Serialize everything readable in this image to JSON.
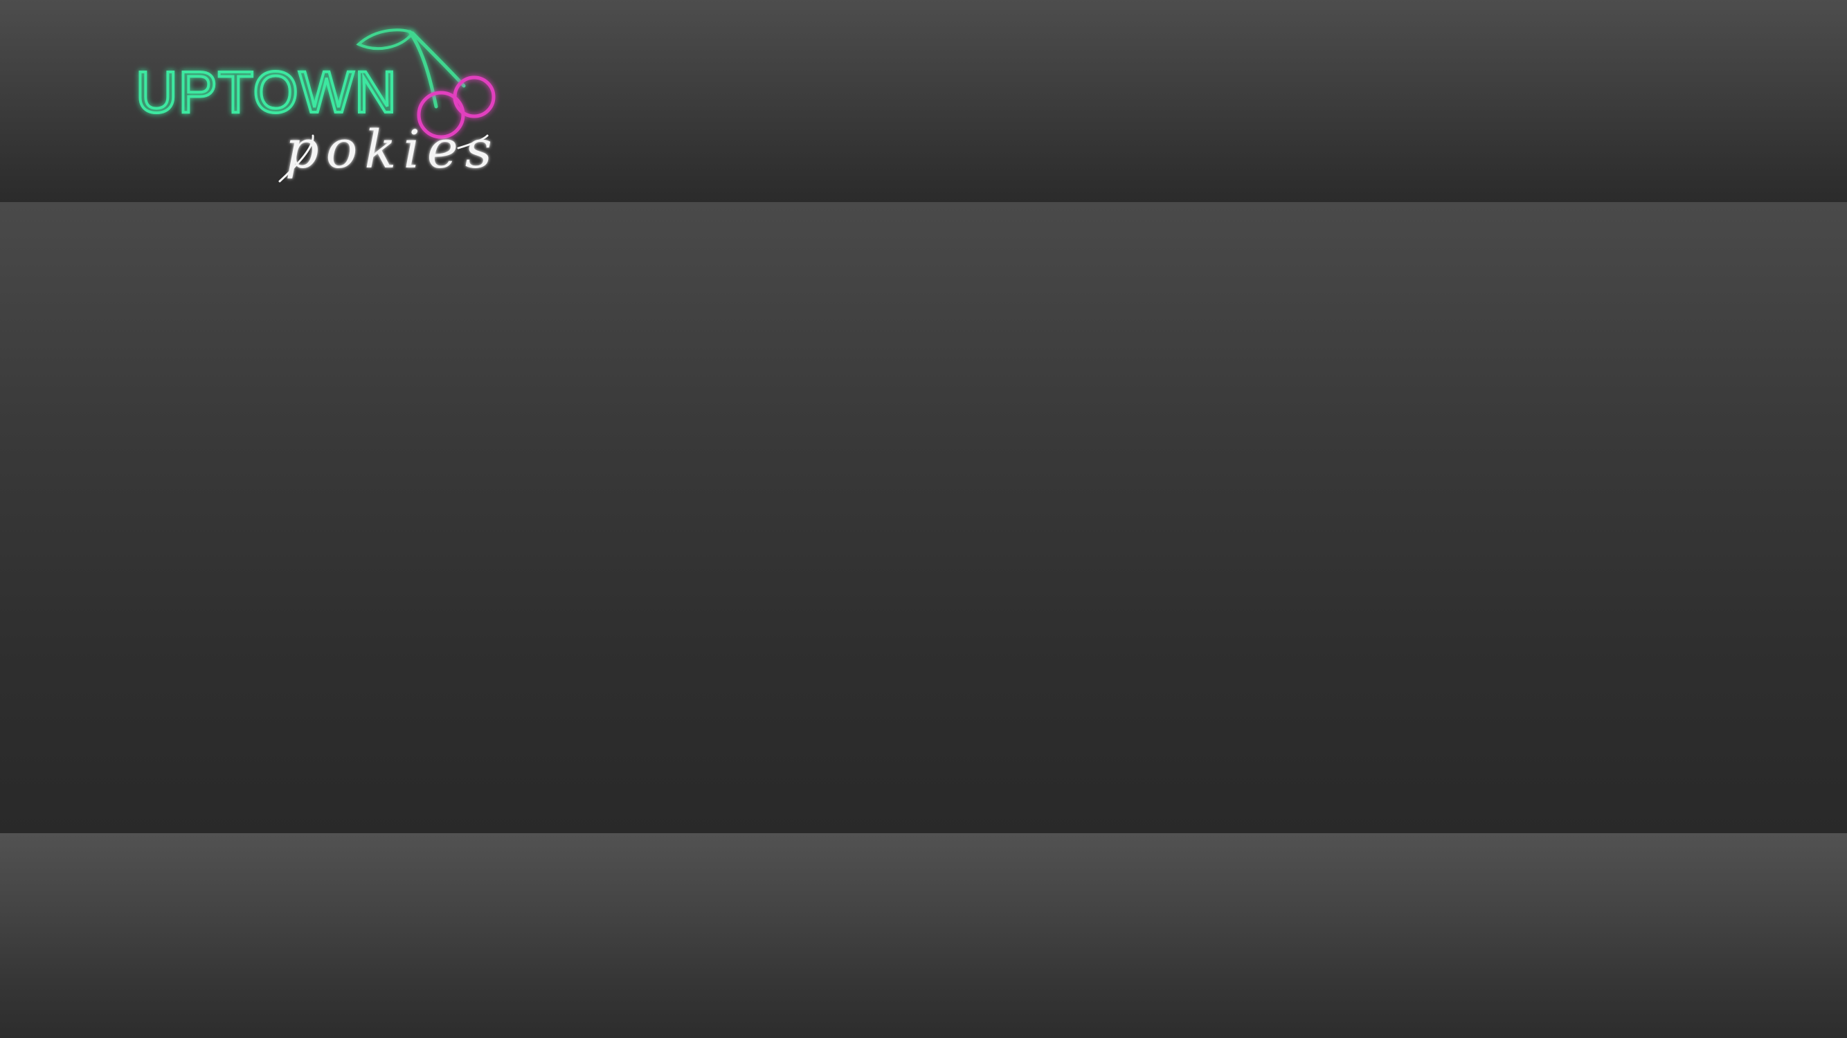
{
  "header": {
    "logo": {
      "word": "UPTOWN",
      "script": "pokies",
      "colors": {
        "neon_green": "#3ee8a0",
        "neon_pink": "#e23fbf",
        "script_white": "#f4f4f4",
        "leaf_green": "#3fd68f"
      },
      "icon": "cherry-icon"
    }
  },
  "colors": {
    "background_top": "#4d4d4d",
    "background_bottom": "#2a2a2a"
  }
}
